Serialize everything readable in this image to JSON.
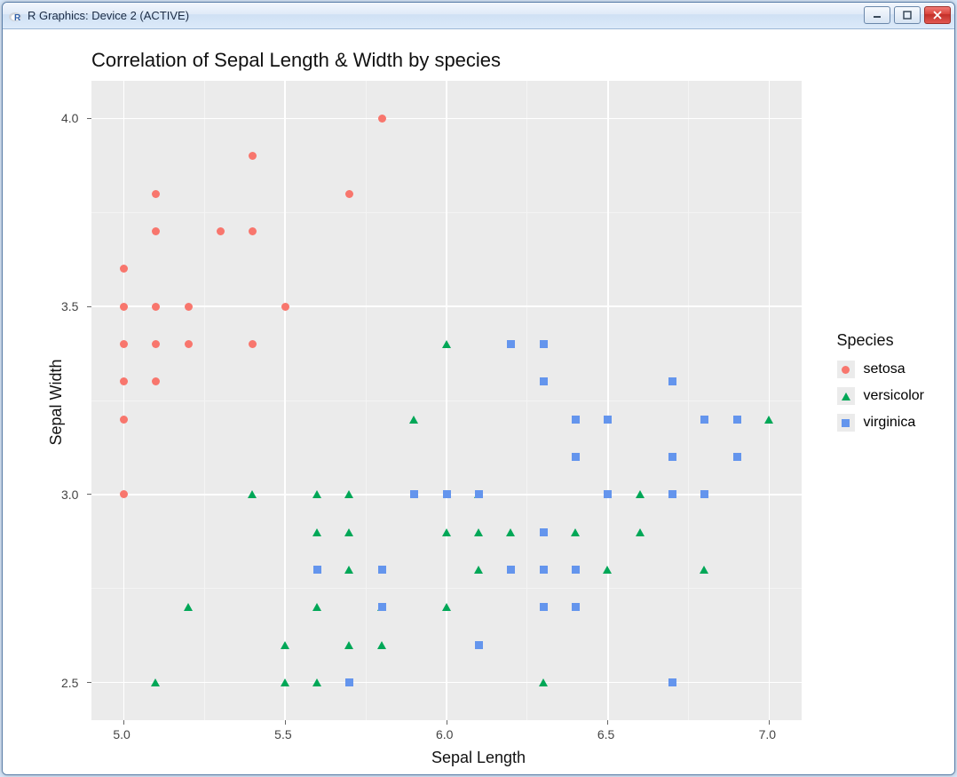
{
  "window": {
    "title": "R Graphics: Device 2 (ACTIVE)"
  },
  "chart_data": {
    "type": "scatter",
    "title": "Correlation of Sepal Length & Width by species",
    "xlabel": "Sepal Length",
    "ylabel": "Sepal Width",
    "xlim": [
      4.9,
      7.1
    ],
    "ylim": [
      2.4,
      4.1
    ],
    "x_ticks": [
      5.0,
      5.5,
      6.0,
      6.5,
      7.0
    ],
    "y_ticks": [
      2.5,
      3.0,
      3.5,
      4.0
    ],
    "x_minor": [
      5.25,
      5.75,
      6.25,
      6.75
    ],
    "y_minor": [
      2.75,
      3.25,
      3.75
    ],
    "legend_title": "Species",
    "legend_position": "right",
    "grid": true,
    "series": [
      {
        "name": "setosa",
        "shape": "circle",
        "color": "#f8766d",
        "points": [
          {
            "x": 5.0,
            "y": 3.6
          },
          {
            "x": 5.0,
            "y": 3.5
          },
          {
            "x": 5.0,
            "y": 3.4
          },
          {
            "x": 5.0,
            "y": 3.3
          },
          {
            "x": 5.0,
            "y": 3.2
          },
          {
            "x": 5.0,
            "y": 3.0
          },
          {
            "x": 5.1,
            "y": 3.8
          },
          {
            "x": 5.1,
            "y": 3.7
          },
          {
            "x": 5.1,
            "y": 3.5
          },
          {
            "x": 5.1,
            "y": 3.4
          },
          {
            "x": 5.1,
            "y": 3.3
          },
          {
            "x": 5.2,
            "y": 3.5
          },
          {
            "x": 5.2,
            "y": 3.4
          },
          {
            "x": 5.3,
            "y": 3.7
          },
          {
            "x": 5.4,
            "y": 3.9
          },
          {
            "x": 5.4,
            "y": 3.7
          },
          {
            "x": 5.4,
            "y": 3.4
          },
          {
            "x": 5.5,
            "y": 3.5
          },
          {
            "x": 5.7,
            "y": 3.8
          },
          {
            "x": 5.8,
            "y": 4.0
          }
        ]
      },
      {
        "name": "versicolor",
        "shape": "triangle",
        "color": "#00a757",
        "points": [
          {
            "x": 5.1,
            "y": 2.5
          },
          {
            "x": 5.2,
            "y": 2.7
          },
          {
            "x": 5.4,
            "y": 3.0
          },
          {
            "x": 5.5,
            "y": 2.6
          },
          {
            "x": 5.5,
            "y": 2.5
          },
          {
            "x": 5.6,
            "y": 3.0
          },
          {
            "x": 5.6,
            "y": 2.9
          },
          {
            "x": 5.6,
            "y": 2.7
          },
          {
            "x": 5.6,
            "y": 2.5
          },
          {
            "x": 5.7,
            "y": 3.0
          },
          {
            "x": 5.7,
            "y": 2.9
          },
          {
            "x": 5.7,
            "y": 2.8
          },
          {
            "x": 5.7,
            "y": 2.6
          },
          {
            "x": 5.8,
            "y": 2.7
          },
          {
            "x": 5.8,
            "y": 2.6
          },
          {
            "x": 5.9,
            "y": 3.2
          },
          {
            "x": 6.0,
            "y": 3.4
          },
          {
            "x": 6.0,
            "y": 2.9
          },
          {
            "x": 6.0,
            "y": 2.7
          },
          {
            "x": 6.1,
            "y": 3.0
          },
          {
            "x": 6.1,
            "y": 2.9
          },
          {
            "x": 6.1,
            "y": 2.8
          },
          {
            "x": 6.2,
            "y": 2.9
          },
          {
            "x": 6.3,
            "y": 2.5
          },
          {
            "x": 6.4,
            "y": 2.9
          },
          {
            "x": 6.5,
            "y": 2.8
          },
          {
            "x": 6.6,
            "y": 3.0
          },
          {
            "x": 6.6,
            "y": 2.9
          },
          {
            "x": 6.8,
            "y": 2.8
          },
          {
            "x": 7.0,
            "y": 3.2
          }
        ]
      },
      {
        "name": "virginica",
        "shape": "square",
        "color": "#6495ed",
        "points": [
          {
            "x": 5.6,
            "y": 2.8
          },
          {
            "x": 5.7,
            "y": 2.5
          },
          {
            "x": 5.8,
            "y": 2.8
          },
          {
            "x": 5.8,
            "y": 2.7
          },
          {
            "x": 5.9,
            "y": 3.0
          },
          {
            "x": 6.0,
            "y": 3.0
          },
          {
            "x": 6.1,
            "y": 3.0
          },
          {
            "x": 6.1,
            "y": 2.6
          },
          {
            "x": 6.2,
            "y": 3.4
          },
          {
            "x": 6.2,
            "y": 2.8
          },
          {
            "x": 6.3,
            "y": 3.4
          },
          {
            "x": 6.3,
            "y": 3.3
          },
          {
            "x": 6.3,
            "y": 2.9
          },
          {
            "x": 6.3,
            "y": 2.8
          },
          {
            "x": 6.3,
            "y": 2.7
          },
          {
            "x": 6.4,
            "y": 3.2
          },
          {
            "x": 6.4,
            "y": 3.1
          },
          {
            "x": 6.4,
            "y": 2.8
          },
          {
            "x": 6.4,
            "y": 2.7
          },
          {
            "x": 6.5,
            "y": 3.2
          },
          {
            "x": 6.5,
            "y": 3.0
          },
          {
            "x": 6.7,
            "y": 3.3
          },
          {
            "x": 6.7,
            "y": 3.1
          },
          {
            "x": 6.7,
            "y": 3.0
          },
          {
            "x": 6.7,
            "y": 2.5
          },
          {
            "x": 6.8,
            "y": 3.2
          },
          {
            "x": 6.8,
            "y": 3.0
          },
          {
            "x": 6.9,
            "y": 3.2
          },
          {
            "x": 6.9,
            "y": 3.1
          }
        ]
      }
    ]
  }
}
